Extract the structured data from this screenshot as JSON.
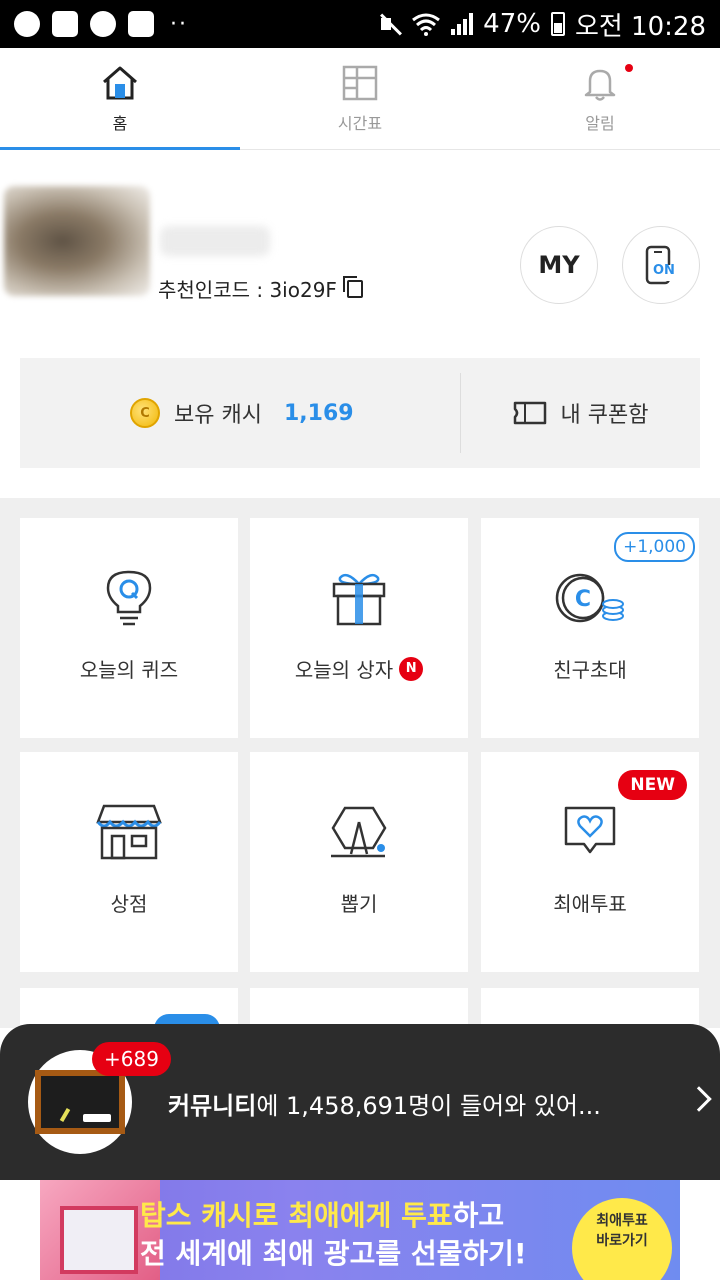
{
  "status_bar": {
    "battery": "47%",
    "time": "오전 10:28"
  },
  "tabs": [
    {
      "label": "홈",
      "active": true
    },
    {
      "label": "시간표",
      "active": false
    },
    {
      "label": "알림",
      "active": false
    }
  ],
  "profile": {
    "referral": "추천인코드 : 3io29F",
    "my_label": "MY",
    "on_label": "ON"
  },
  "cash": {
    "label": "보유 캐시",
    "value": "1,169",
    "coin_glyph": "C",
    "coupon_label": "내 쿠폰함"
  },
  "grid": [
    {
      "label": "오늘의 퀴즈"
    },
    {
      "label": "오늘의 상자",
      "badge": "N"
    },
    {
      "label": "친구초대",
      "bubble": "+1,000"
    },
    {
      "label": "상점"
    },
    {
      "label": "뽑기"
    },
    {
      "label": "최애투표",
      "bubble": "NEW"
    }
  ],
  "community": {
    "badge": "+689",
    "strong": "커뮤니티",
    "rest": "에 1,458,691명이 들어와 있어..."
  },
  "banner": {
    "line1_highlight": "탑스 캐시로 최애에게 투표",
    "line1_rest": "하고",
    "line2": "전 세계에 최애 광고를 선물하기!",
    "button_line1": "최애투표",
    "button_line2": "바로가기"
  },
  "colors": {
    "accent": "#2a8ee8",
    "red": "#e60012",
    "dark_bar": "#2c2c2c"
  }
}
